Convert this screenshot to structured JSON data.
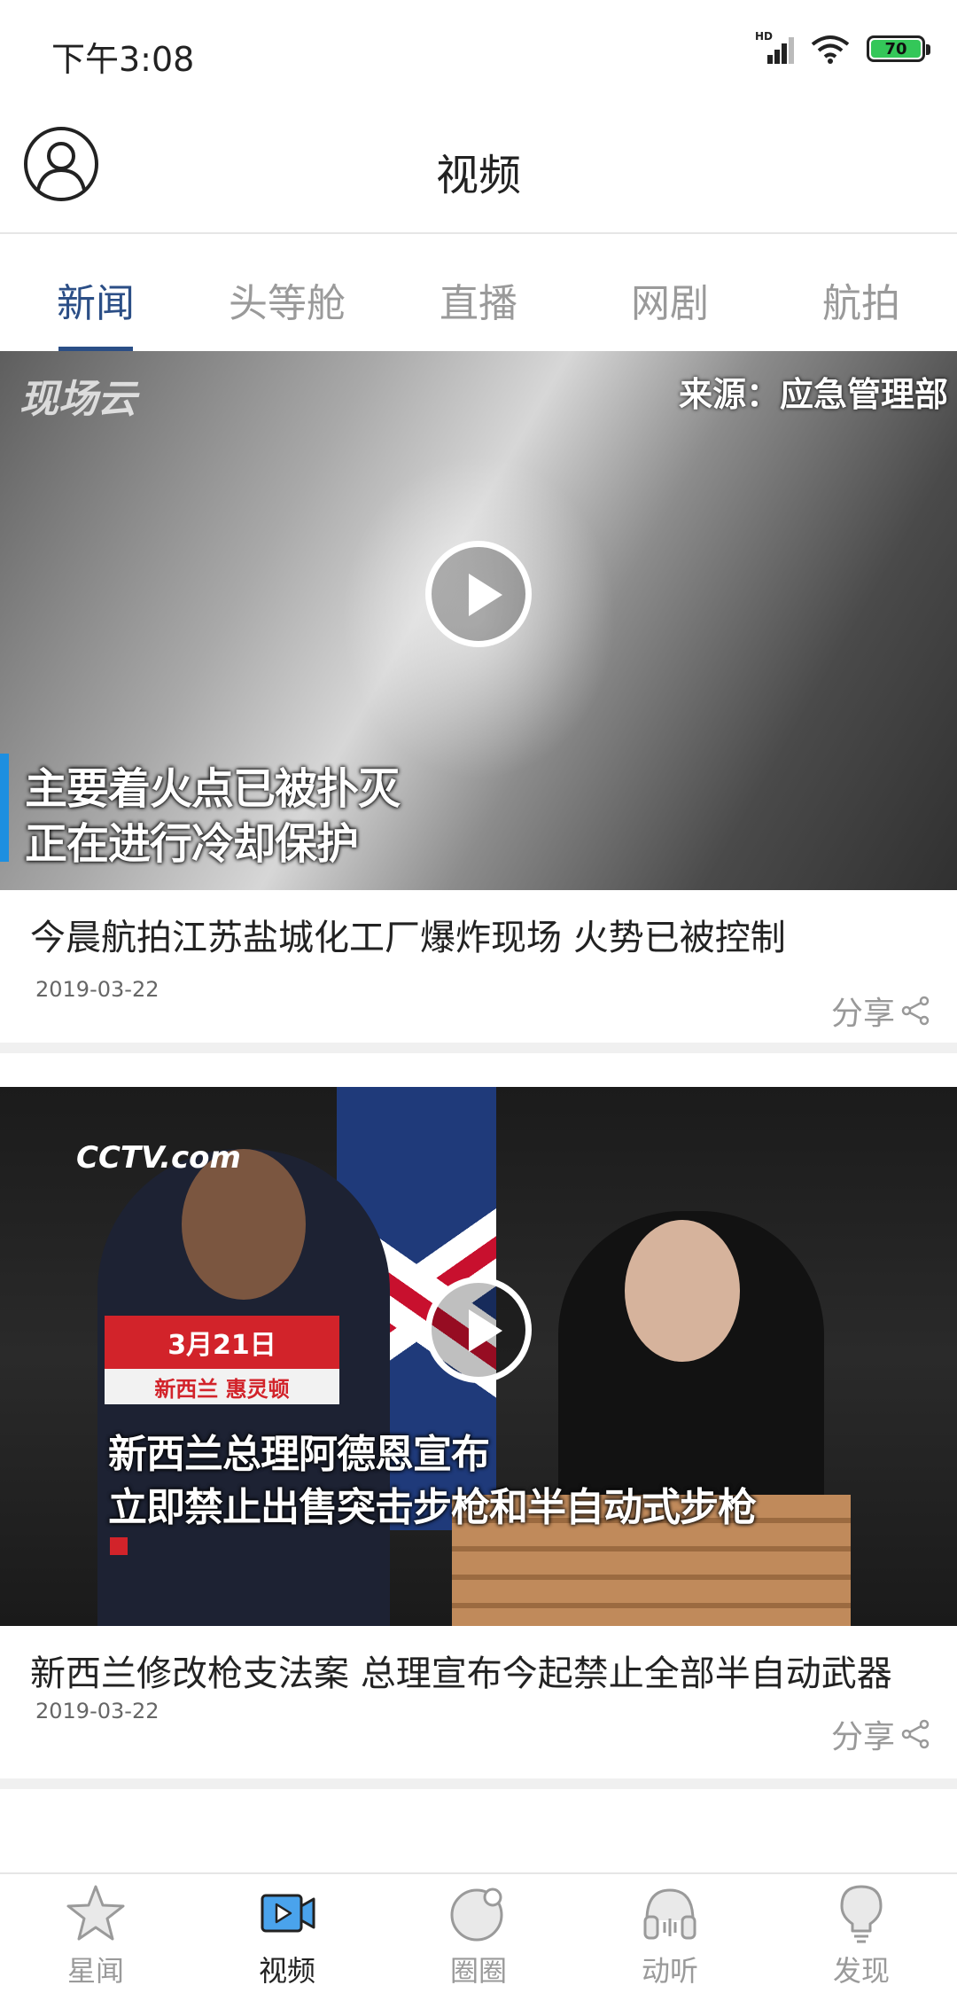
{
  "status_bar": {
    "time": "下午3:08",
    "battery": "70"
  },
  "header": {
    "title": "视频"
  },
  "tabs": [
    {
      "label": "新闻",
      "active": true
    },
    {
      "label": "头等舱",
      "active": false
    },
    {
      "label": "直播",
      "active": false
    },
    {
      "label": "网剧",
      "active": false
    },
    {
      "label": "航拍",
      "active": false
    }
  ],
  "feed": [
    {
      "watermark_left": "现场云",
      "watermark_right": "来源：应急管理部",
      "caption_line1": "主要着火点已被扑灭",
      "caption_line2": "正在进行冷却保护",
      "title": "今晨航拍江苏盐城化工厂爆炸现场 火势已被控制",
      "date": "2019-03-22",
      "share_label": "分享"
    },
    {
      "watermark_left": "CCTV.com",
      "date_box_top": "3月21日",
      "date_box_bottom": "新西兰 惠灵顿",
      "caption_line1": "新西兰总理阿德恩宣布",
      "caption_line2": "立即禁止出售突击步枪和半自动式步枪",
      "title": "新西兰修改枪支法案 总理宣布今起禁止全部半自动武器",
      "date": "2019-03-22",
      "share_label": "分享"
    }
  ],
  "bottom_nav": [
    {
      "label": "星闻",
      "icon": "star-icon",
      "active": false
    },
    {
      "label": "视频",
      "icon": "video-icon",
      "active": true
    },
    {
      "label": "圈圈",
      "icon": "circle-icon",
      "active": false
    },
    {
      "label": "动听",
      "icon": "headphones-icon",
      "active": false
    },
    {
      "label": "发现",
      "icon": "bulb-icon",
      "active": false
    }
  ],
  "colors": {
    "accent": "#2b4e86",
    "inactive": "#9a9a9a",
    "video_icon_blue": "#4aa3ec"
  }
}
